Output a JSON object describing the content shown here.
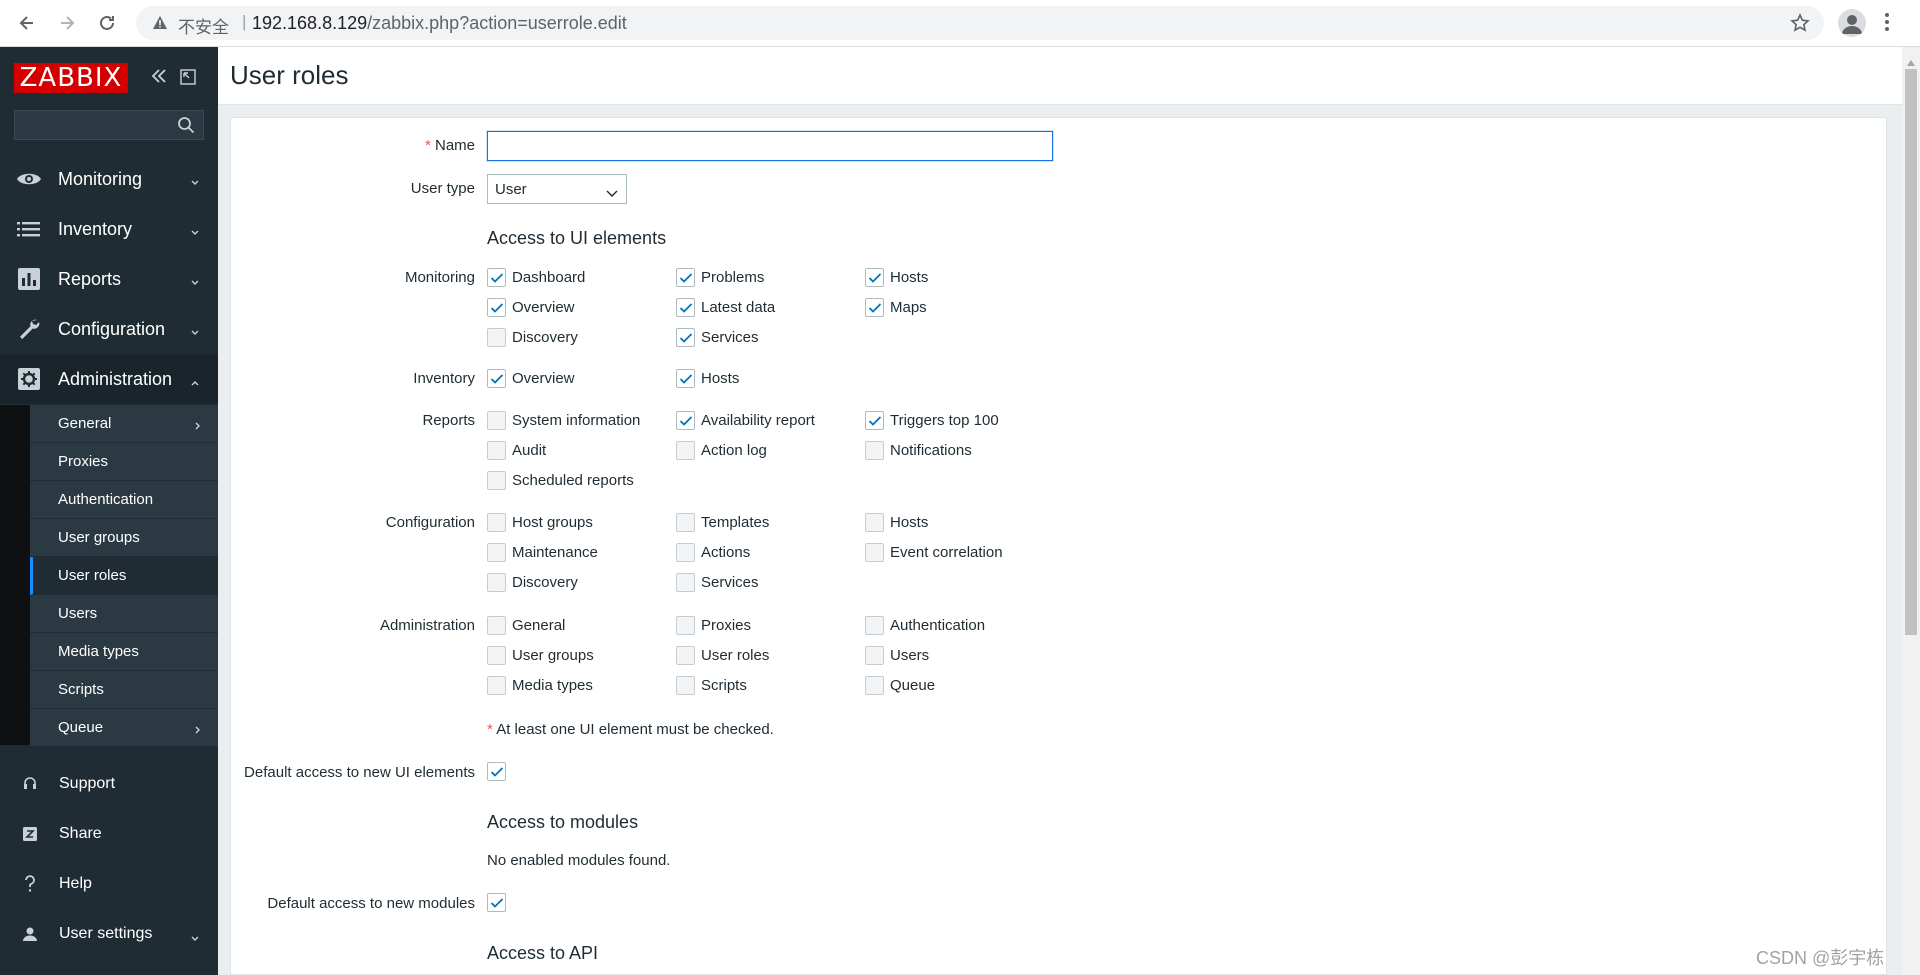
{
  "browser": {
    "insecure_label": "不安全",
    "separator": "|",
    "url_host": "192.168.8.129",
    "url_path": "/zabbix.php?action=userrole.edit"
  },
  "sidebar": {
    "logo": "ZABBIX",
    "search_placeholder": "",
    "menu": [
      {
        "label": "Monitoring",
        "icon": "eye-icon"
      },
      {
        "label": "Inventory",
        "icon": "list-icon"
      },
      {
        "label": "Reports",
        "icon": "bar-chart-icon"
      },
      {
        "label": "Configuration",
        "icon": "wrench-icon"
      },
      {
        "label": "Administration",
        "icon": "gear-icon"
      }
    ],
    "submenu": [
      {
        "label": "General"
      },
      {
        "label": "Proxies"
      },
      {
        "label": "Authentication"
      },
      {
        "label": "User groups"
      },
      {
        "label": "User roles"
      },
      {
        "label": "Users"
      },
      {
        "label": "Media types"
      },
      {
        "label": "Scripts"
      },
      {
        "label": "Queue"
      }
    ],
    "footer": [
      {
        "label": "Support",
        "icon": "headset-icon"
      },
      {
        "label": "Share",
        "icon": "share-z-icon"
      },
      {
        "label": "Help",
        "icon": "help-icon"
      },
      {
        "label": "User settings",
        "icon": "user-icon"
      }
    ]
  },
  "page": {
    "title": "User roles"
  },
  "form": {
    "required_mark": "*",
    "name_label": "Name",
    "name_value": "",
    "user_type_label": "User type",
    "user_type_value": "User",
    "ui_section": "Access to UI elements",
    "groups": {
      "monitoring": {
        "label": "Monitoring",
        "items": [
          {
            "label": "Dashboard",
            "checked": true
          },
          {
            "label": "Problems",
            "checked": true
          },
          {
            "label": "Hosts",
            "checked": true
          },
          {
            "label": "Overview",
            "checked": true
          },
          {
            "label": "Latest data",
            "checked": true
          },
          {
            "label": "Maps",
            "checked": true
          },
          {
            "label": "Discovery",
            "checked": false
          },
          {
            "label": "Services",
            "checked": true
          }
        ]
      },
      "inventory": {
        "label": "Inventory",
        "items": [
          {
            "label": "Overview",
            "checked": true
          },
          {
            "label": "Hosts",
            "checked": true
          }
        ]
      },
      "reports": {
        "label": "Reports",
        "items": [
          {
            "label": "System information",
            "checked": false
          },
          {
            "label": "Availability report",
            "checked": true
          },
          {
            "label": "Triggers top 100",
            "checked": true
          },
          {
            "label": "Audit",
            "checked": false
          },
          {
            "label": "Action log",
            "checked": false
          },
          {
            "label": "Notifications",
            "checked": false
          },
          {
            "label": "Scheduled reports",
            "checked": false
          }
        ]
      },
      "configuration": {
        "label": "Configuration",
        "items": [
          {
            "label": "Host groups",
            "checked": false
          },
          {
            "label": "Templates",
            "checked": false
          },
          {
            "label": "Hosts",
            "checked": false
          },
          {
            "label": "Maintenance",
            "checked": false
          },
          {
            "label": "Actions",
            "checked": false
          },
          {
            "label": "Event correlation",
            "checked": false
          },
          {
            "label": "Discovery",
            "checked": false
          },
          {
            "label": "Services",
            "checked": false
          }
        ]
      },
      "administration": {
        "label": "Administration",
        "items": [
          {
            "label": "General",
            "checked": false
          },
          {
            "label": "Proxies",
            "checked": false
          },
          {
            "label": "Authentication",
            "checked": false
          },
          {
            "label": "User groups",
            "checked": false
          },
          {
            "label": "User roles",
            "checked": false
          },
          {
            "label": "Users",
            "checked": false
          },
          {
            "label": "Media types",
            "checked": false
          },
          {
            "label": "Scripts",
            "checked": false
          },
          {
            "label": "Queue",
            "checked": false
          }
        ]
      }
    },
    "ui_note": "At least one UI element must be checked.",
    "default_ui_label": "Default access to new UI elements",
    "default_ui_checked": true,
    "modules_section": "Access to modules",
    "modules_empty": "No enabled modules found.",
    "default_modules_label": "Default access to new modules",
    "default_modules_checked": true,
    "api_section": "Access to API"
  },
  "watermark": "CSDN @彭宇栋",
  "colors": {
    "sidebar_bg": "#1f2c33",
    "logo_red": "#d40000",
    "submenu_bg": "#2b3a42",
    "accent_blue": "#1a8cff",
    "required_red": "#e45959",
    "check_blue": "#0275b8"
  }
}
